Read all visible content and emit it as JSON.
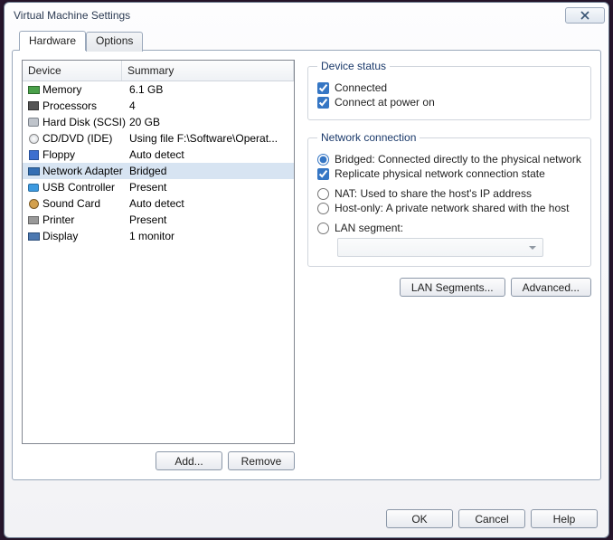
{
  "window": {
    "title": "Virtual Machine Settings"
  },
  "tabs": {
    "hardware": "Hardware",
    "options": "Options"
  },
  "list": {
    "header_device": "Device",
    "header_summary": "Summary",
    "rows": [
      {
        "icon": "memory-icon",
        "name": "Memory",
        "summary": "6.1 GB"
      },
      {
        "icon": "processor-icon",
        "name": "Processors",
        "summary": "4"
      },
      {
        "icon": "harddisk-icon",
        "name": "Hard Disk (SCSI)",
        "summary": "20 GB"
      },
      {
        "icon": "cd-icon",
        "name": "CD/DVD (IDE)",
        "summary": "Using file F:\\Software\\Operat..."
      },
      {
        "icon": "floppy-icon",
        "name": "Floppy",
        "summary": "Auto detect"
      },
      {
        "icon": "network-icon",
        "name": "Network Adapter",
        "summary": "Bridged"
      },
      {
        "icon": "usb-icon",
        "name": "USB Controller",
        "summary": "Present"
      },
      {
        "icon": "sound-icon",
        "name": "Sound Card",
        "summary": "Auto detect"
      },
      {
        "icon": "printer-icon",
        "name": "Printer",
        "summary": "Present"
      },
      {
        "icon": "display-icon",
        "name": "Display",
        "summary": "1 monitor"
      }
    ],
    "selected_index": 5
  },
  "buttons": {
    "add": "Add...",
    "remove": "Remove",
    "lan_segments": "LAN Segments...",
    "advanced": "Advanced...",
    "ok": "OK",
    "cancel": "Cancel",
    "help": "Help"
  },
  "device_status": {
    "legend": "Device status",
    "connected": "Connected",
    "connect_at_power_on": "Connect at power on"
  },
  "network": {
    "legend": "Network connection",
    "bridged": "Bridged: Connected directly to the physical network",
    "replicate": "Replicate physical network connection state",
    "nat": "NAT: Used to share the host's IP address",
    "host_only": "Host-only: A private network shared with the host",
    "lan_segment": "LAN segment:"
  }
}
